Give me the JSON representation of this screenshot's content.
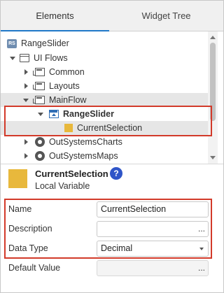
{
  "tabs": [
    {
      "label": "Elements",
      "active": true
    },
    {
      "label": "Widget Tree",
      "active": false
    }
  ],
  "tree": [
    {
      "label": "RangeSlider",
      "icon": "app-icon",
      "badge": "RS"
    },
    {
      "label": "UI Flows",
      "icon": "folder-open-icon"
    },
    {
      "label": "Common",
      "icon": "flow-icon"
    },
    {
      "label": "Layouts",
      "icon": "flow-icon"
    },
    {
      "label": "MainFlow",
      "icon": "flow-icon"
    },
    {
      "label": "RangeSlider",
      "icon": "screen-icon"
    },
    {
      "label": "CurrentSelection",
      "icon": "local-variable-icon"
    },
    {
      "label": "OutSystemsCharts",
      "icon": "dependency-icon"
    },
    {
      "label": "OutSystemsMaps",
      "icon": "dependency-icon"
    }
  ],
  "details": {
    "title": "CurrentSelection",
    "subtitle": "Local Variable",
    "help": "?"
  },
  "properties": {
    "name_label": "Name",
    "name_value": "CurrentSelection",
    "description_label": "Description",
    "description_value": "",
    "description_button": "...",
    "datatype_label": "Data Type",
    "datatype_value": "Decimal",
    "default_label": "Default Value",
    "default_value": "",
    "default_button": "..."
  },
  "colors": {
    "highlight_border": "#d23a2a",
    "active_tab_underline": "#1f78c8",
    "variable_icon": "#e8b83c",
    "help_icon": "#2f55c8"
  }
}
